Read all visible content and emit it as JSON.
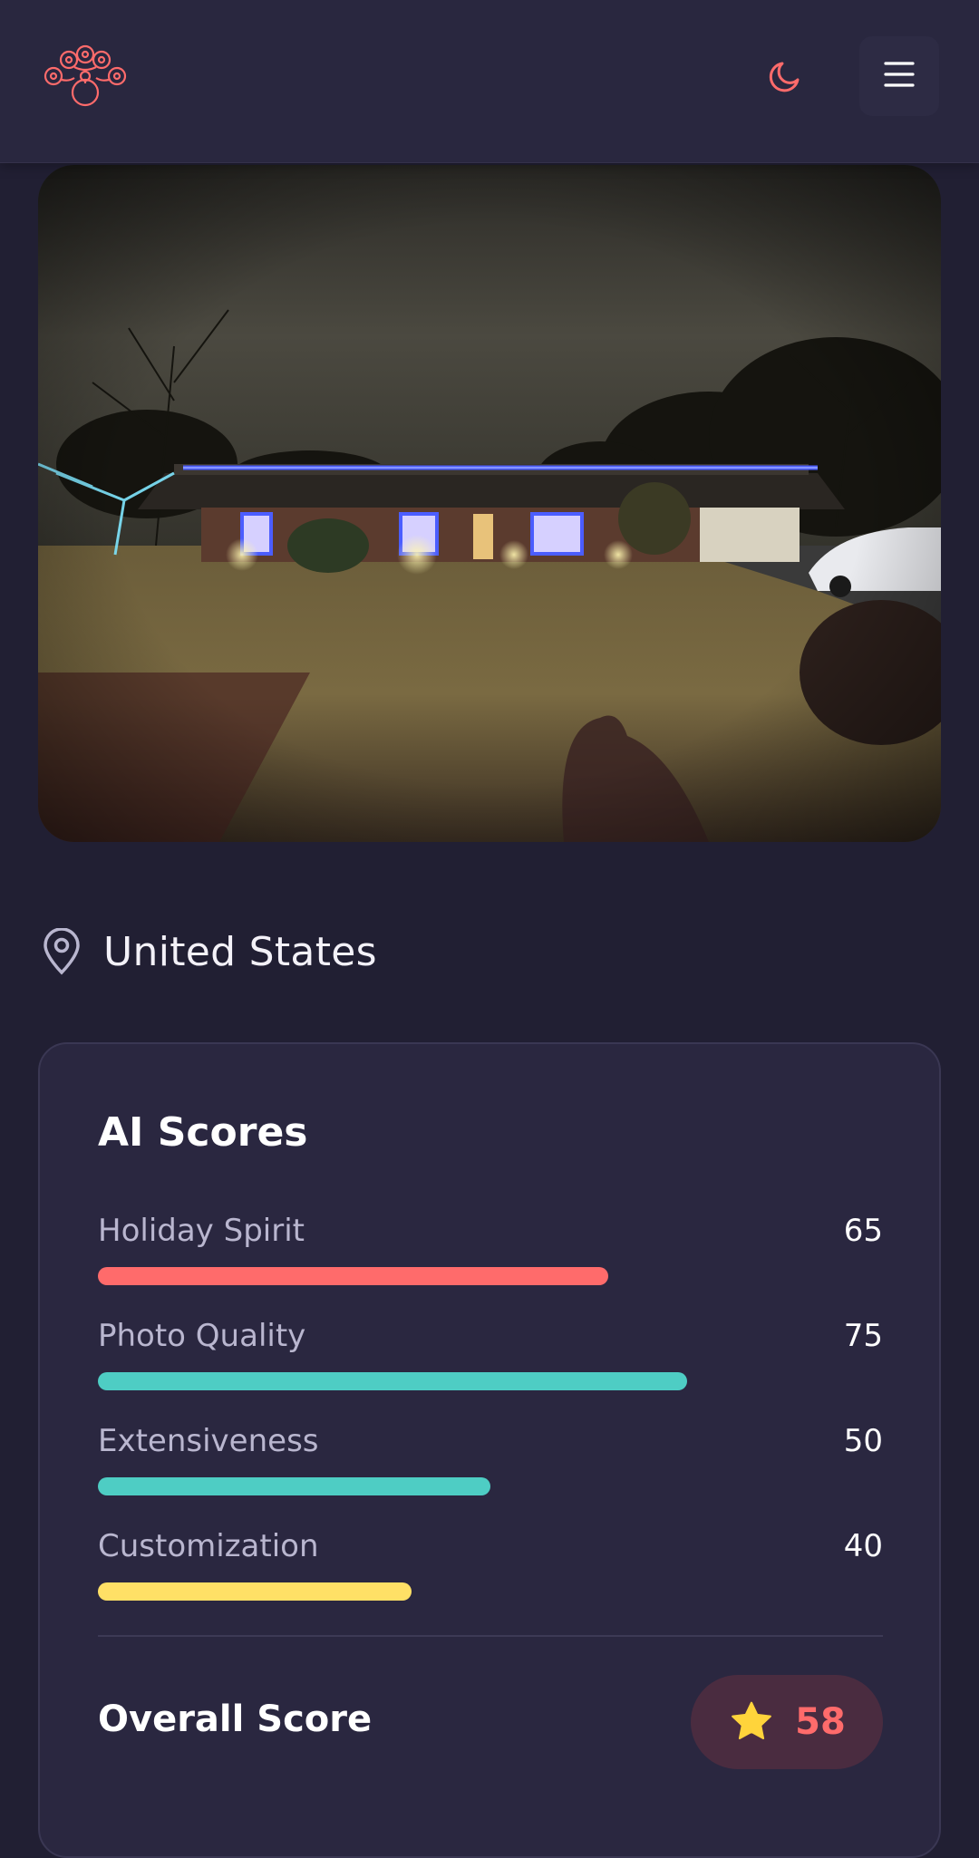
{
  "header": {
    "logo_icon": "peacock-logo-icon",
    "theme_toggle_icon": "moon-icon",
    "menu_icon": "hamburger-menu-icon"
  },
  "photo": {
    "subject": "house-with-holiday-lights-photo"
  },
  "location": {
    "icon": "map-pin-icon",
    "text": "United States"
  },
  "scores": {
    "title": "AI Scores",
    "items": [
      {
        "label": "Holiday Spirit",
        "value": "65",
        "percent": 65,
        "color": "#ff6b6b"
      },
      {
        "label": "Photo Quality",
        "value": "75",
        "percent": 75,
        "color": "#4ecdc4"
      },
      {
        "label": "Extensiveness",
        "value": "50",
        "percent": 50,
        "color": "#4ecdc4"
      },
      {
        "label": "Customization",
        "value": "40",
        "percent": 40,
        "color": "#ffe066"
      }
    ],
    "overall_label": "Overall Score",
    "overall_value": "58",
    "overall_icon": "star-icon"
  },
  "colors": {
    "accent": "#ff6b6b",
    "background": "#211f33",
    "header": "#29273f",
    "card": "#2a2740",
    "star": "#ffd43b"
  }
}
